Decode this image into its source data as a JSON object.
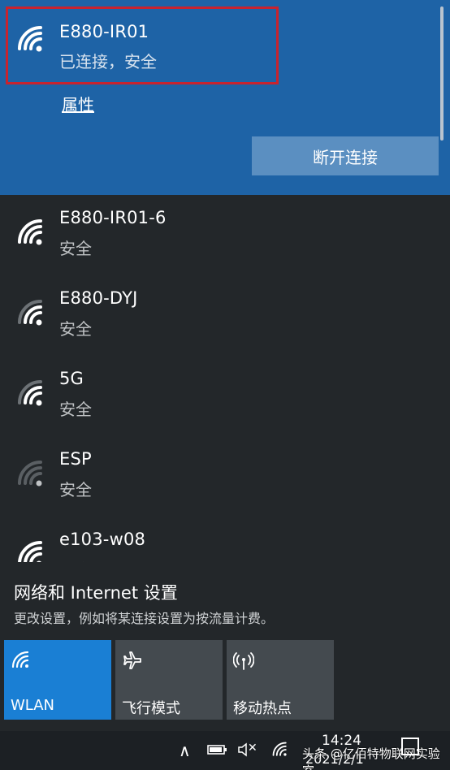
{
  "connected_network": {
    "name": "E880-IR01",
    "status": "已连接，安全",
    "properties_label": "属性",
    "disconnect_label": "断开连接"
  },
  "networks": [
    {
      "name": "E880-IR01-6",
      "status": "安全",
      "signal_bars": 4
    },
    {
      "name": "E880-DYJ",
      "status": "安全",
      "signal_bars": 3
    },
    {
      "name": "5G",
      "status": "安全",
      "signal_bars": 3
    },
    {
      "name": "ESP",
      "status": "安全",
      "signal_bars": 1
    },
    {
      "name": "e103-w08",
      "status": "安全",
      "signal_bars": 4
    }
  ],
  "settings": {
    "title": "网络和 Internet 设置",
    "subtitle": "更改设置，例如将某连接设置为按流量计费。"
  },
  "quick_actions": [
    {
      "label": "WLAN",
      "icon": "wifi-icon",
      "active": true
    },
    {
      "label": "飞行模式",
      "icon": "airplane-icon",
      "active": false
    },
    {
      "label": "移动热点",
      "icon": "hotspot-icon",
      "active": false
    }
  ],
  "taskbar": {
    "time": "14:24",
    "date": "2021/2/1",
    "watermark": "头条 @亿佰特物联网实验室",
    "chevron": "∧",
    "mute_symbol": "✕"
  },
  "colors": {
    "connected_bg": "#1e63a6",
    "accent": "#1a7fd4",
    "panel_bg": "#23272a",
    "highlight": "#c8232e"
  }
}
